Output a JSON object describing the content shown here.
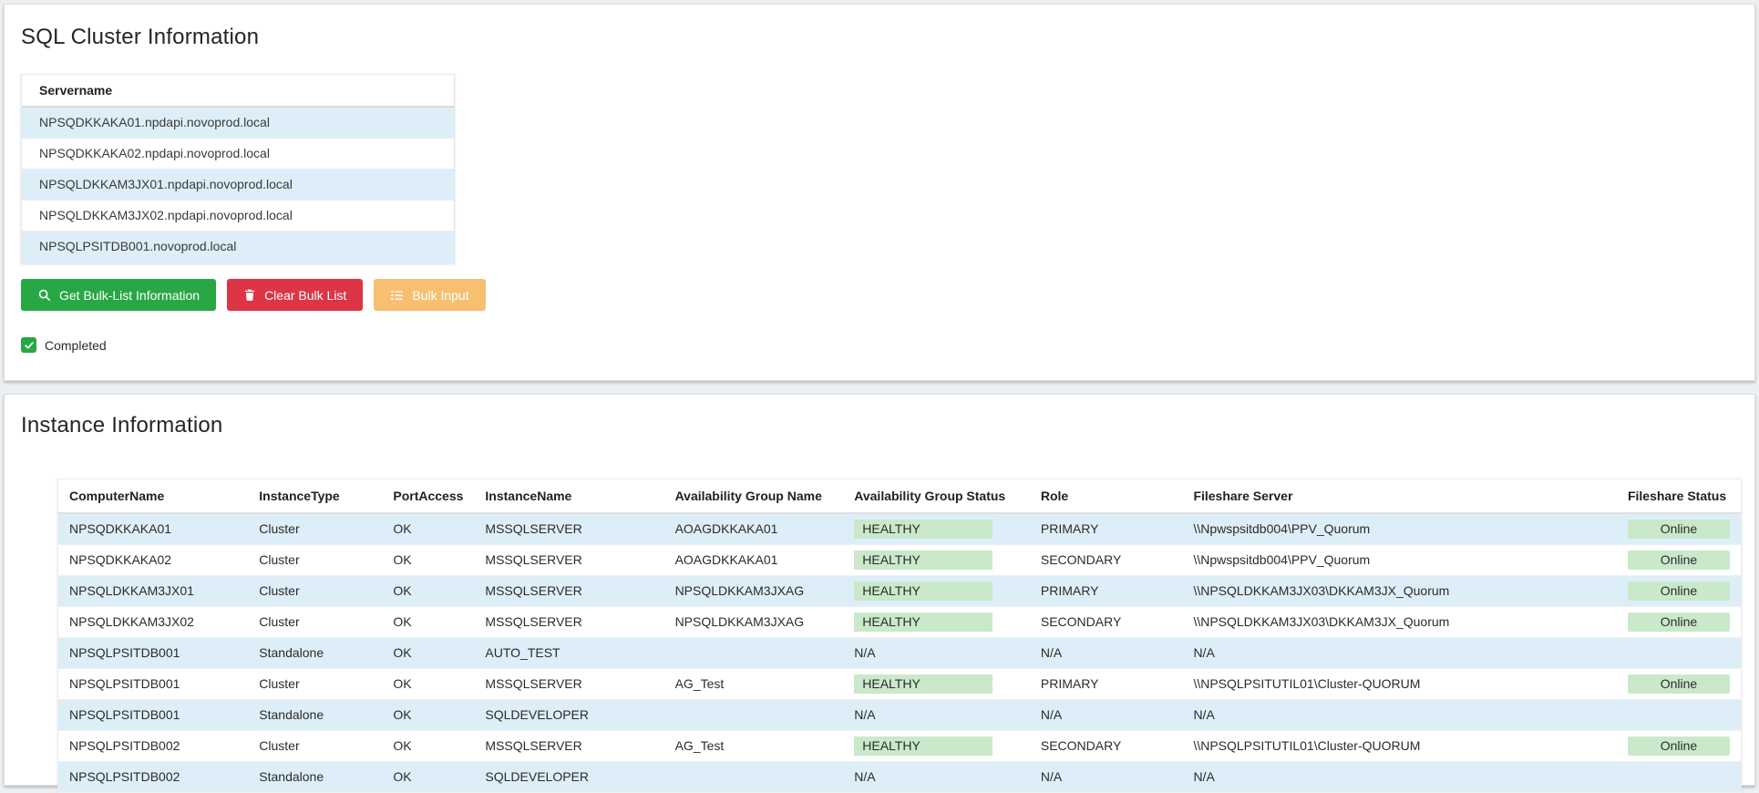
{
  "colors": {
    "success_green": "#28a745",
    "danger_red": "#dc3545",
    "warning_orange": "#f8bf71",
    "badge_green": "#c9e9ca",
    "stripe_blue": "#ddeef9"
  },
  "cluster_panel": {
    "title": "SQL Cluster Information",
    "server_table": {
      "header": "Servername",
      "rows": [
        "NPSQDKKAKA01.npdapi.novoprod.local",
        "NPSQDKKAKA02.npdapi.novoprod.local",
        "NPSQLDKKAM3JX01.npdapi.novoprod.local",
        "NPSQLDKKAM3JX02.npdapi.novoprod.local",
        "NPSQLPSITDB001.novoprod.local"
      ]
    },
    "buttons": {
      "get_bulk_list": "Get Bulk-List Information",
      "clear_bulk_list": "Clear Bulk List",
      "bulk_input": "Bulk Input"
    },
    "status_checkbox": {
      "label": "Completed",
      "checked": true
    }
  },
  "instance_panel": {
    "title": "Instance Information",
    "table": {
      "columns": [
        "ComputerName",
        "InstanceType",
        "PortAccess",
        "InstanceName",
        "Availability Group Name",
        "Availability Group Status",
        "Role",
        "Fileshare Server",
        "Fileshare Status"
      ],
      "rows": [
        [
          "NPSQDKKAKA01",
          "Cluster",
          "OK",
          "MSSQLSERVER",
          "AOAGDKKAKA01",
          "HEALTHY",
          "PRIMARY",
          "\\\\Npwspsitdb004\\PPV_Quorum",
          "Online"
        ],
        [
          "NPSQDKKAKA02",
          "Cluster",
          "OK",
          "MSSQLSERVER",
          "AOAGDKKAKA01",
          "HEALTHY",
          "SECONDARY",
          "\\\\Npwspsitdb004\\PPV_Quorum",
          "Online"
        ],
        [
          "NPSQLDKKAM3JX01",
          "Cluster",
          "OK",
          "MSSQLSERVER",
          "NPSQLDKKAM3JXAG",
          "HEALTHY",
          "PRIMARY",
          "\\\\NPSQLDKKAM3JX03\\DKKAM3JX_Quorum",
          "Online"
        ],
        [
          "NPSQLDKKAM3JX02",
          "Cluster",
          "OK",
          "MSSQLSERVER",
          "NPSQLDKKAM3JXAG",
          "HEALTHY",
          "SECONDARY",
          "\\\\NPSQLDKKAM3JX03\\DKKAM3JX_Quorum",
          "Online"
        ],
        [
          "NPSQLPSITDB001",
          "Standalone",
          "OK",
          "AUTO_TEST",
          "",
          "N/A",
          "N/A",
          "N/A",
          ""
        ],
        [
          "NPSQLPSITDB001",
          "Cluster",
          "OK",
          "MSSQLSERVER",
          "AG_Test",
          "HEALTHY",
          "PRIMARY",
          "\\\\NPSQLPSITUTIL01\\Cluster-QUORUM",
          "Online"
        ],
        [
          "NPSQLPSITDB001",
          "Standalone",
          "OK",
          "SQLDEVELOPER",
          "",
          "N/A",
          "N/A",
          "N/A",
          ""
        ],
        [
          "NPSQLPSITDB002",
          "Cluster",
          "OK",
          "MSSQLSERVER",
          "AG_Test",
          "HEALTHY",
          "SECONDARY",
          "\\\\NPSQLPSITUTIL01\\Cluster-QUORUM",
          "Online"
        ],
        [
          "NPSQLPSITDB002",
          "Standalone",
          "OK",
          "SQLDEVELOPER",
          "",
          "N/A",
          "N/A",
          "N/A",
          ""
        ]
      ]
    }
  }
}
